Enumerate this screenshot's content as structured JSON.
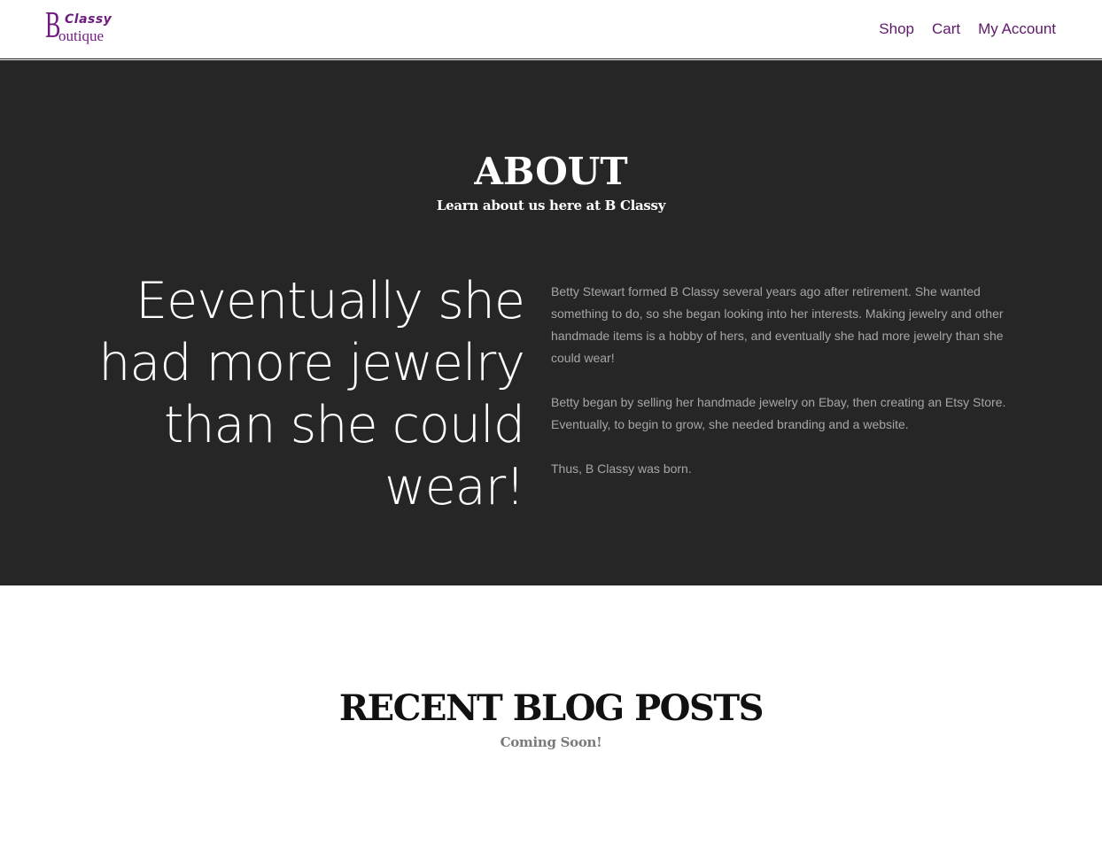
{
  "header": {
    "logo": {
      "letter": "B",
      "word_top": "Classy",
      "word_bottom": "outique"
    },
    "nav": [
      {
        "label": "Shop"
      },
      {
        "label": "Cart"
      },
      {
        "label": "My Account"
      }
    ]
  },
  "about": {
    "title": "ABOUT",
    "subtitle": "Learn about us here at B Classy",
    "headline": "Eeventually she had more jewelry than she could wear!",
    "paragraphs": [
      "Betty Stewart formed B Classy several years ago after retirement. She wanted something to do, so she began looking into her interests. Making jewelry and other handmade items is a hobby of hers, and eventually she had more jewelry than she could wear!",
      "Betty began by selling her handmade jewelry on Ebay, then creating an Etsy Store. Eventually, to begin to grow, she needed branding and a website.",
      "Thus, B Classy was born."
    ]
  },
  "blog": {
    "title": "RECENT BLOG POSTS",
    "subtitle": "Coming Soon!"
  },
  "colors": {
    "brand_purple": "#6e1a7e",
    "nav_link": "#5e1a6a",
    "about_background": "#262626",
    "about_body_text": "#a6a6a6"
  }
}
